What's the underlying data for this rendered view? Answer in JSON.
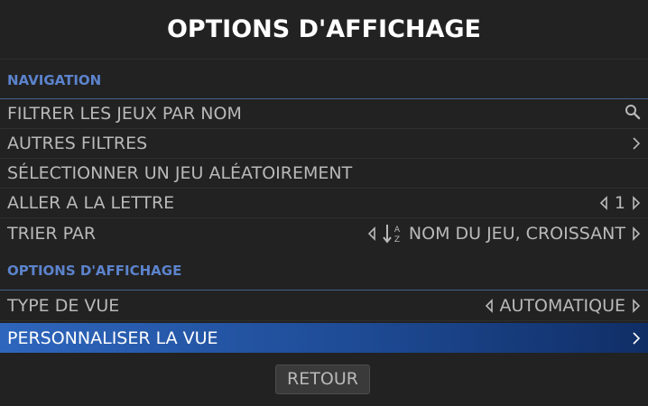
{
  "title": "OPTIONS D'AFFICHAGE",
  "sections": {
    "navigation": {
      "header": "NAVIGATION",
      "items": [
        {
          "label": "FILTRER LES JEUX PAR NOM",
          "icon": "search-icon"
        },
        {
          "label": "AUTRES FILTRES",
          "icon": "chevron-right-icon"
        },
        {
          "label": "SÉLECTIONNER UN JEU ALÉATOIREMENT"
        },
        {
          "label": "ALLER A LA LETTRE",
          "value": "1"
        },
        {
          "label": "TRIER PAR",
          "value": "NOM DU JEU, CROISSANT",
          "icon": "sort-alpha-asc-icon"
        }
      ]
    },
    "display": {
      "header": "OPTIONS D'AFFICHAGE",
      "items": [
        {
          "label": "TYPE DE VUE",
          "value": "AUTOMATIQUE"
        },
        {
          "label": "PERSONNALISER LA VUE",
          "icon": "chevron-right-icon",
          "selected": true
        }
      ]
    }
  },
  "back_button": "RETOUR",
  "colors": {
    "background": "#222222",
    "title": "#ffffff",
    "section_header": "#5c83cc",
    "text": "#b9b9b9",
    "selection_start": "#2e66bd",
    "selection_end": "#102e66"
  }
}
